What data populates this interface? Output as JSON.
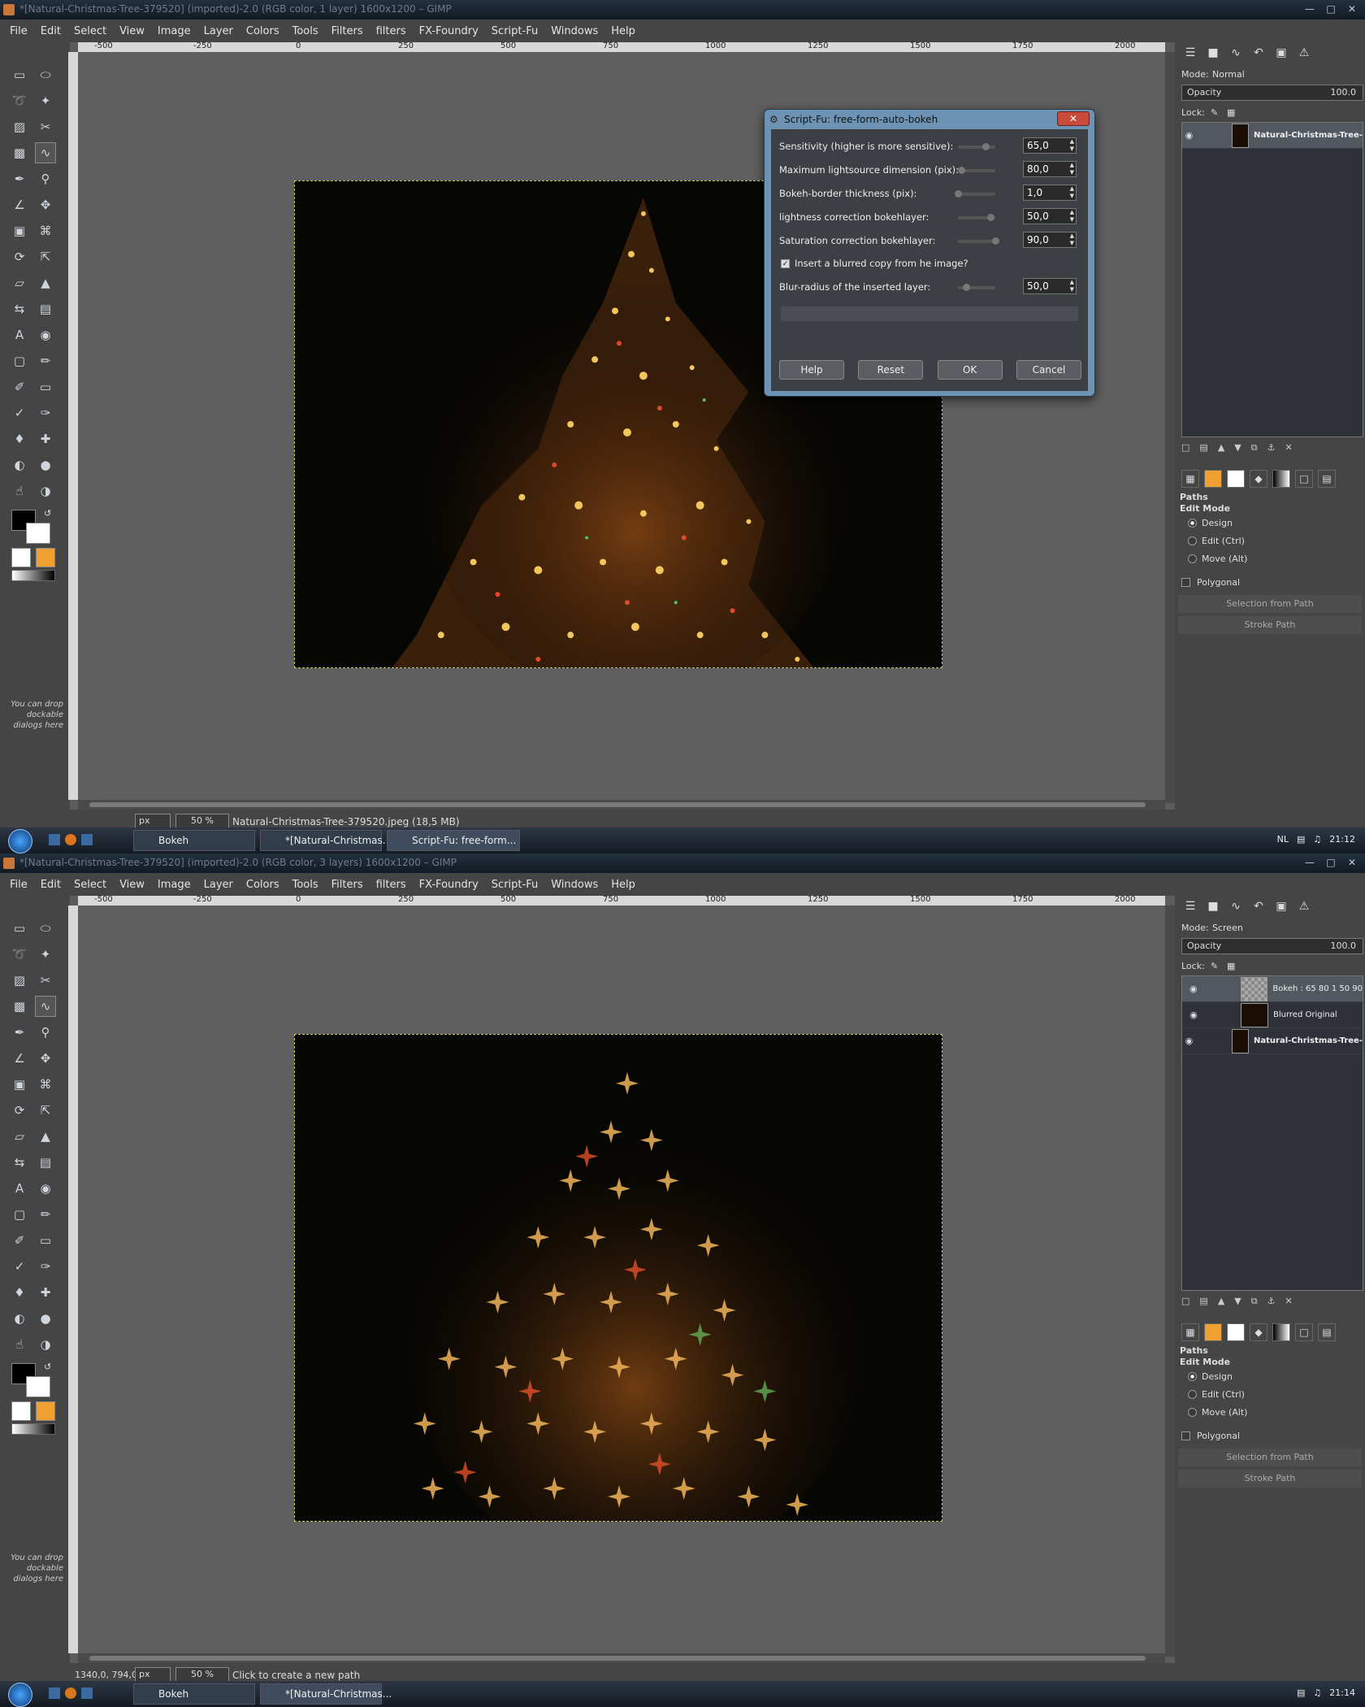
{
  "top": {
    "window_title": "*[Natural-Christmas-Tree-379520] (imported)-2.0 (RGB color, 1 layer) 1600x1200 – GIMP",
    "menu": [
      "File",
      "Edit",
      "Select",
      "View",
      "Image",
      "Layer",
      "Colors",
      "Tools",
      "Filters",
      "filters",
      "FX-Foundry",
      "Script-Fu",
      "Windows",
      "Help"
    ],
    "ruler_labels": [
      "-500",
      "-250",
      "0",
      "250",
      "500",
      "750",
      "1000",
      "1250",
      "1500",
      "1750",
      "2000"
    ],
    "dock_mode_label": "Mode:",
    "dock_mode_value": "Normal",
    "opacity_label": "Opacity",
    "opacity_value": "100.0",
    "lock_label": "Lock:",
    "layers": [
      {
        "name": "Natural-Christmas-Tree-",
        "thumb": "dark",
        "bold": true,
        "active": true
      }
    ],
    "paths_title": "Paths",
    "edit_mode_label": "Edit Mode",
    "radios": [
      "Design",
      "Edit (Ctrl)",
      "Move (Alt)"
    ],
    "polygonal": "Polygonal",
    "selection_from_path": "Selection from Path",
    "stroke_path": "Stroke Path",
    "drop_hint": "You can drop dockable dialogs here",
    "status_coords": "",
    "status_unit": "px",
    "status_zoom": "50 %",
    "status_msg": "Natural-Christmas-Tree-379520.jpeg (18,5 MB)",
    "dialog": {
      "title": "Script-Fu: free-form-auto-bokeh",
      "params": [
        {
          "label": "Sensitivity (higher is more sensitive):",
          "value": "65,0"
        },
        {
          "label": "Maximum lightsource dimension (pix):",
          "value": "80,0"
        },
        {
          "label": "Bokeh-border thickness (pix):",
          "value": "1,0"
        },
        {
          "label": "lightness correction bokehlayer:",
          "value": "50,0"
        },
        {
          "label": "Saturation correction bokehlayer:",
          "value": "90,0"
        }
      ],
      "checkbox_label": "Insert a blurred copy from he image?",
      "checkbox_checked": true,
      "blur_label": "Blur-radius of the inserted layer:",
      "blur_value": "50,0",
      "buttons": {
        "help": "Help",
        "reset": "Reset",
        "ok": "OK",
        "cancel": "Cancel"
      }
    },
    "taskbar": [
      "Bokeh",
      "*[Natural-Christmas...",
      "Script-Fu: free-form..."
    ],
    "tray_lang": "NL",
    "clock": "21:12"
  },
  "bottom": {
    "window_title": "*[Natural-Christmas-Tree-379520] (imported)-2.0 (RGB color, 3 layers) 1600x1200 – GIMP",
    "dock_mode_value": "Screen",
    "opacity_value": "100.0",
    "layers": [
      {
        "name": "Bokeh : 65 80 1 50 90",
        "thumb": "checker",
        "bold": false,
        "active": true
      },
      {
        "name": "Blurred Original",
        "thumb": "dark",
        "bold": false,
        "active": false
      },
      {
        "name": "Natural-Christmas-Tree-",
        "thumb": "dark",
        "bold": true,
        "active": false
      }
    ],
    "status_coords": "1340,0, 794,0",
    "status_unit": "px",
    "status_zoom": "50 %",
    "status_msg": "Click to create a new path",
    "taskbar": [
      "Bokeh",
      "*[Natural-Christmas..."
    ],
    "clock": "21:14"
  },
  "colors": {
    "accent_canvas_border": "#c8c85a",
    "dialog_frame": "#6d93b4"
  }
}
